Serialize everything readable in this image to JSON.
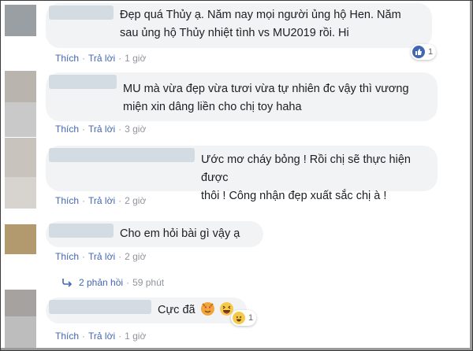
{
  "comments": [
    {
      "text_lines": [
        "Đẹp quá Thủy ạ. Năm nay mọi người ủng hộ Hen. Năm",
        "sau ủng hộ Thủy nhiệt tình vs MU2019 rồi. Hi"
      ],
      "like": "Thích",
      "reply": "Trả lời",
      "time": "1 giờ",
      "reaction_count": "1",
      "reaction_icon": "like-icon"
    },
    {
      "text_lines": [
        "MU mà vừa đẹp vừa tươi vừa tự nhiên đc vậy thì vương",
        "miện xin dâng liền cho chị toy haha"
      ],
      "like": "Thích",
      "reply": "Trả lời",
      "time": "3 giờ"
    },
    {
      "text_lines": [
        "Ước mơ cháy bỏng ! Rồi chị sẽ thực hiện được",
        "thôi ! Công nhận đẹp xuất sắc chị à !"
      ],
      "like": "Thích",
      "reply": "Trả lời",
      "time": "2 giờ"
    },
    {
      "text_lines": [
        "Cho em hỏi bài gì vậy ạ"
      ],
      "like": "Thích",
      "reply": "Trả lời",
      "time": "2 giờ",
      "replies_label": "2 phản hồi",
      "replies_time": "59 phút"
    },
    {
      "text_lines": [
        "Cực đã"
      ],
      "like": "Thích",
      "reply": "Trả lời",
      "time": "1 giờ",
      "reaction_count": "1",
      "reaction_icon": "haha-icon",
      "emoji_icons": [
        "heart-eyes-cat-icon",
        "grinning-squint-icon"
      ]
    }
  ],
  "separator": "·",
  "colors": {
    "link": "#4267b2",
    "meta": "#90949c",
    "bubble": "#f2f3f5"
  }
}
